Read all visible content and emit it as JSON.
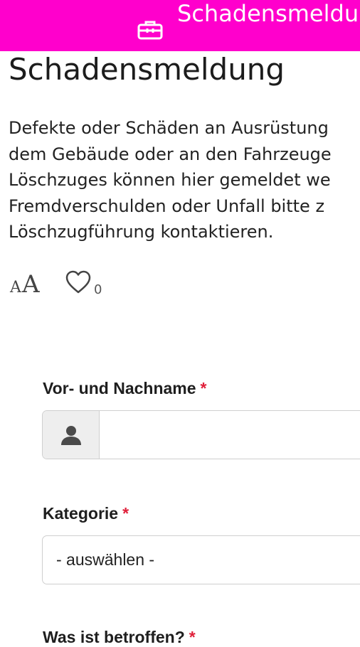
{
  "header": {
    "icon": "briefcase-icon",
    "title": "Schadensmeldu"
  },
  "page": {
    "title": "Schadensmeldung",
    "description_lines": [
      "Defekte oder Schäden an Ausrüstung",
      "dem Gebäude oder an den Fahrzeuge",
      "Löschzuges können hier gemeldet we",
      "Fremdverschulden oder Unfall bitte z",
      "Löschzugführung kontaktieren."
    ]
  },
  "tools": {
    "font_size_small": "A",
    "font_size_large": "A",
    "like_icon": "heart-icon",
    "like_count": "0"
  },
  "form": {
    "name": {
      "label": "Vor- und Nachname",
      "required_mark": "*",
      "icon": "user-icon",
      "value": "",
      "placeholder": ""
    },
    "category": {
      "label": "Kategorie",
      "required_mark": "*",
      "selected": "- auswählen -"
    },
    "affected": {
      "label": "Was ist betroffen?",
      "required_mark": "*"
    }
  },
  "colors": {
    "header_bg": "#ff00cc",
    "required": "#e0203a"
  }
}
